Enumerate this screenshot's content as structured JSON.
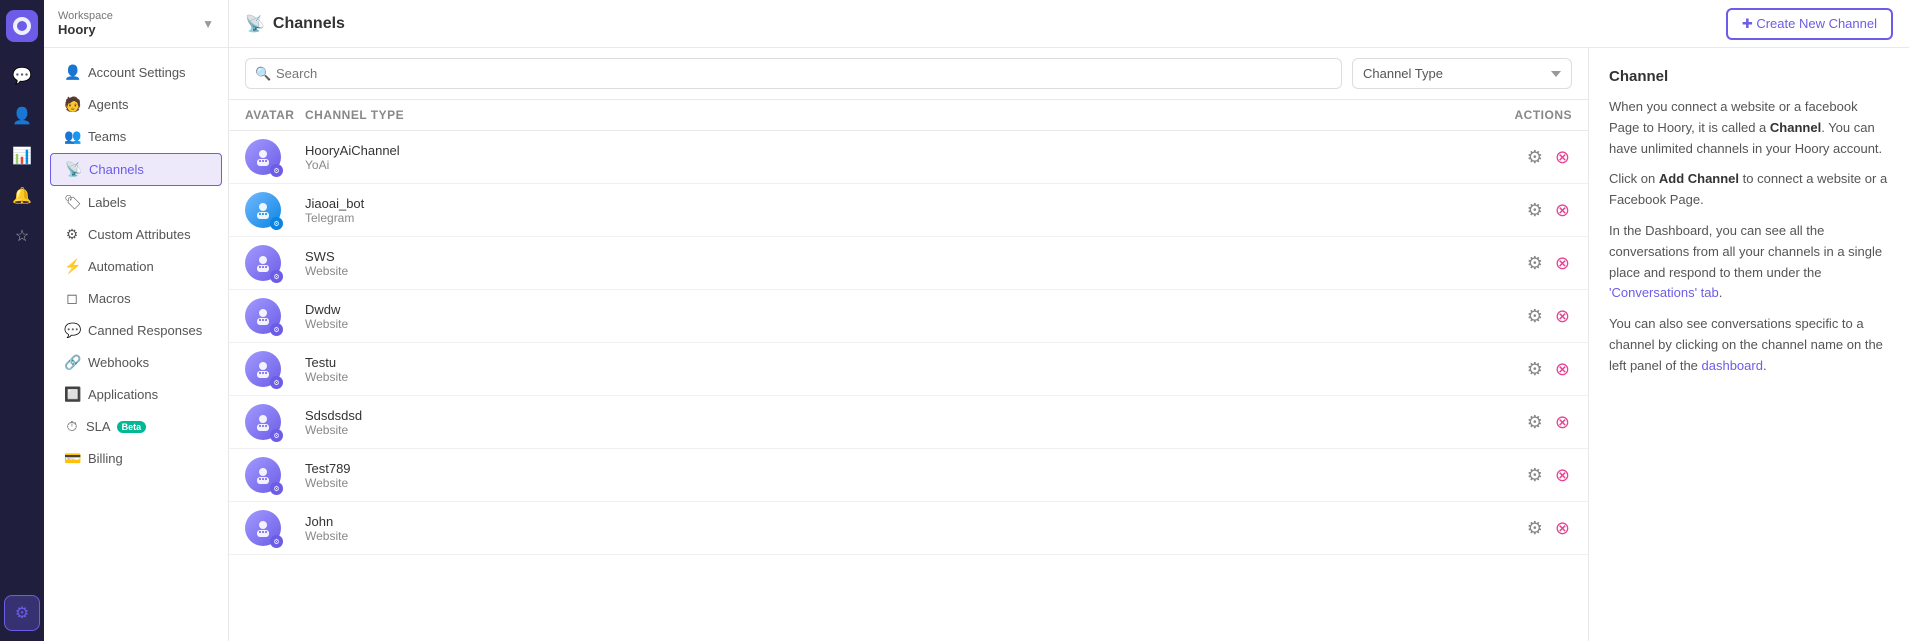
{
  "workspace": {
    "name": "Hoory",
    "label": "Workspace"
  },
  "sidebar": {
    "items": [
      {
        "id": "account-settings",
        "label": "Account Settings",
        "icon": "👤"
      },
      {
        "id": "agents",
        "label": "Agents",
        "icon": "🧑"
      },
      {
        "id": "teams",
        "label": "Teams",
        "icon": "👥"
      },
      {
        "id": "channels",
        "label": "Channels",
        "icon": "📡",
        "active": true
      },
      {
        "id": "labels",
        "label": "Labels",
        "icon": "🏷"
      },
      {
        "id": "custom-attributes",
        "label": "Custom Attributes",
        "icon": "⚙"
      },
      {
        "id": "automation",
        "label": "Automation",
        "icon": "⚡"
      },
      {
        "id": "macros",
        "label": "Macros",
        "icon": "◻"
      },
      {
        "id": "canned-responses",
        "label": "Canned Responses",
        "icon": "💬"
      },
      {
        "id": "webhooks",
        "label": "Webhooks",
        "icon": "🔗"
      },
      {
        "id": "applications",
        "label": "Applications",
        "icon": "🔲"
      },
      {
        "id": "sla",
        "label": "SLA",
        "icon": "⏱",
        "badge": "Beta"
      },
      {
        "id": "billing",
        "label": "Billing",
        "icon": "💳"
      }
    ]
  },
  "nav_icons": [
    {
      "id": "conversations",
      "icon": "💬"
    },
    {
      "id": "contacts",
      "icon": "👤"
    },
    {
      "id": "reports",
      "icon": "📊"
    },
    {
      "id": "notifications",
      "icon": "🔔"
    },
    {
      "id": "starred",
      "icon": "☆"
    },
    {
      "id": "settings",
      "icon": "⚙",
      "active": true
    }
  ],
  "header": {
    "page_icon": "📡",
    "page_title": "Channels",
    "create_button_label": "✚ Create New Channel"
  },
  "filter_bar": {
    "search_placeholder": "Search",
    "channel_type_placeholder": "Channel Type"
  },
  "table": {
    "columns": [
      "Avatar",
      "Channel Type",
      "Actions"
    ]
  },
  "channels": [
    {
      "id": 1,
      "name": "HooryAiChannel",
      "type": "YoAi"
    },
    {
      "id": 2,
      "name": "Jiaoai_bot",
      "type": "Telegram"
    },
    {
      "id": 3,
      "name": "SWS",
      "type": "Website"
    },
    {
      "id": 4,
      "name": "Dwdw",
      "type": "Website"
    },
    {
      "id": 5,
      "name": "Testu",
      "type": "Website"
    },
    {
      "id": 6,
      "name": "Sdsdsdsd",
      "type": "Website"
    },
    {
      "id": 7,
      "name": "Test789",
      "type": "Website"
    },
    {
      "id": 8,
      "name": "John",
      "type": "Website"
    }
  ],
  "info_panel": {
    "title": "Channel",
    "paragraphs": [
      "When you connect a website or a facebook Page to Hoory, it is called a Channel. You can have unlimited channels in your Hoory account.",
      "Click on Add Channel to connect a website or a Facebook Page.",
      "In the Dashboard, you can see all the conversations from all your channels in a single place and respond to them under the 'Conversations' tab.",
      "You can also see conversations specific to a channel by clicking on the channel name on the left panel of the dashboard."
    ],
    "bold_terms": [
      "Channel",
      "Add Channel",
      "'Conversations' tab"
    ]
  }
}
